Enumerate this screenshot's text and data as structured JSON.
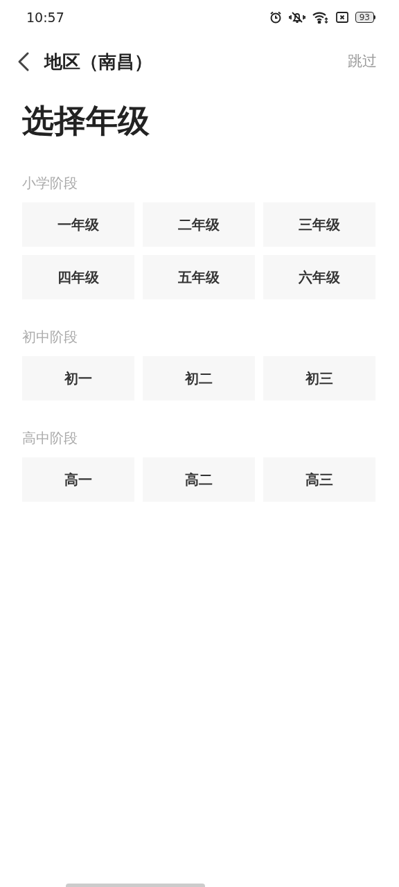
{
  "status_bar": {
    "time": "10:57",
    "battery": "93"
  },
  "nav": {
    "title": "地区（南昌）",
    "skip": "跳过"
  },
  "heading": "选择年级",
  "sections": [
    {
      "label": "小学阶段",
      "grades": [
        "一年级",
        "二年级",
        "三年级",
        "四年级",
        "五年级",
        "六年级"
      ]
    },
    {
      "label": "初中阶段",
      "grades": [
        "初一",
        "初二",
        "初三"
      ]
    },
    {
      "label": "高中阶段",
      "grades": [
        "高一",
        "高二",
        "高三"
      ]
    }
  ]
}
